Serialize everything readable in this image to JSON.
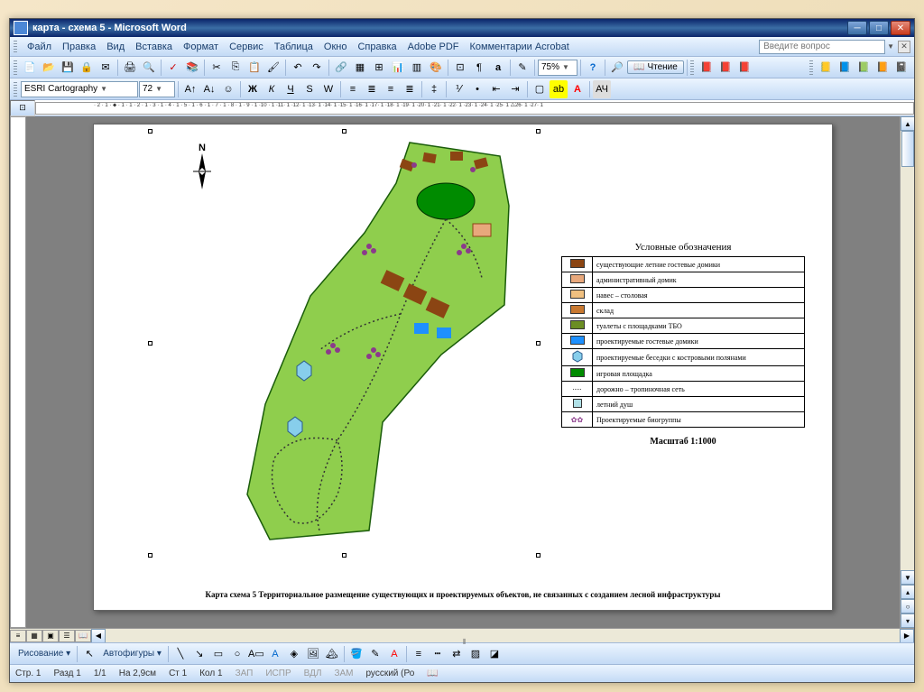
{
  "window": {
    "title": "карта - схема 5 - Microsoft Word"
  },
  "menu": {
    "file": "Файл",
    "edit": "Правка",
    "view": "Вид",
    "insert": "Вставка",
    "format": "Формат",
    "tools": "Сервис",
    "table": "Таблица",
    "window": "Окно",
    "help": "Справка",
    "adobe": "Adobe PDF",
    "acrobat": "Комментарии Acrobat",
    "search_placeholder": "Введите вопрос"
  },
  "toolbar": {
    "font_name": "ESRI Cartography",
    "font_size": "72",
    "zoom": "75%",
    "reading": "Чтение"
  },
  "drawbar": {
    "drawing": "Рисование",
    "autoshapes": "Автофигуры"
  },
  "status": {
    "page": "Стр. 1",
    "section": "Разд 1",
    "pages": "1/1",
    "position": "На 2,9см",
    "line": "Ст 1",
    "col": "Кол 1",
    "rec": "ЗАП",
    "trk": "ИСПР",
    "ext": "ВДЛ",
    "ovr": "ЗАМ",
    "lang": "русский (Ро"
  },
  "document": {
    "compass": "N",
    "legend_title": "Условные обозначения",
    "scale": "Масштаб 1:1000",
    "caption": "Карта схема 5 Территориальное размещение существующих и проектируемых объектов, не связанных с созданием лесной инфраструктуры",
    "legend": [
      {
        "label": "существующие летние гостевые домики",
        "color": "#8b4513"
      },
      {
        "label": "административный домик",
        "color": "#e8a87c"
      },
      {
        "label": "навес – столовая",
        "color": "#f0c080"
      },
      {
        "label": "склад",
        "color": "#c87830"
      },
      {
        "label": "туалеты с площадками ТБО",
        "color": "#6b8e23"
      },
      {
        "label": "проектируемые гостевые домики",
        "color": "#1e90ff"
      },
      {
        "label": "проектируемые беседки с костровыми полянами",
        "color": "#87ceeb"
      },
      {
        "label": "игровая площадка",
        "color": "#008b00"
      },
      {
        "label": "дорожно – тропиночная сеть",
        "color": "path"
      },
      {
        "label": "летний душ",
        "color": "#b0e0e6"
      },
      {
        "label": "Проектируемые биогруппы",
        "color": "bio"
      }
    ]
  }
}
